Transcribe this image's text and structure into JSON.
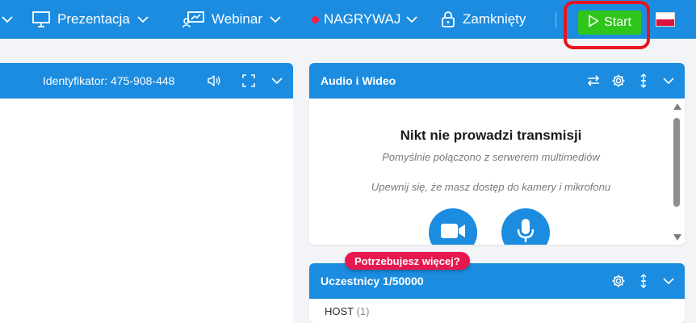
{
  "topbar": {
    "presentation": "Prezentacja",
    "webinar": "Webinar",
    "record": "NAGRYWAJ",
    "locked": "Zamknięty",
    "start": "Start"
  },
  "left_panel": {
    "identifier": "Identyfikator: 475-908-448"
  },
  "audio_video": {
    "title": "Audio i Wideo",
    "no_stream": "Nikt nie prowadzi transmisji",
    "connected": "Pomyślnie połączono z serwerem multimediów",
    "access_hint": "Upewnij się, że masz dostęp do kamery i mikrofonu"
  },
  "promo": "Potrzebujesz więcej?",
  "participants": {
    "title": "Uczestnicy 1/50000",
    "host_label": "HOST",
    "host_count": "(1)"
  },
  "colors": {
    "primary": "#1b8ce0",
    "start_green": "#2fc51c",
    "highlight_red": "#e8141f",
    "promo_pink": "#e8174d"
  }
}
